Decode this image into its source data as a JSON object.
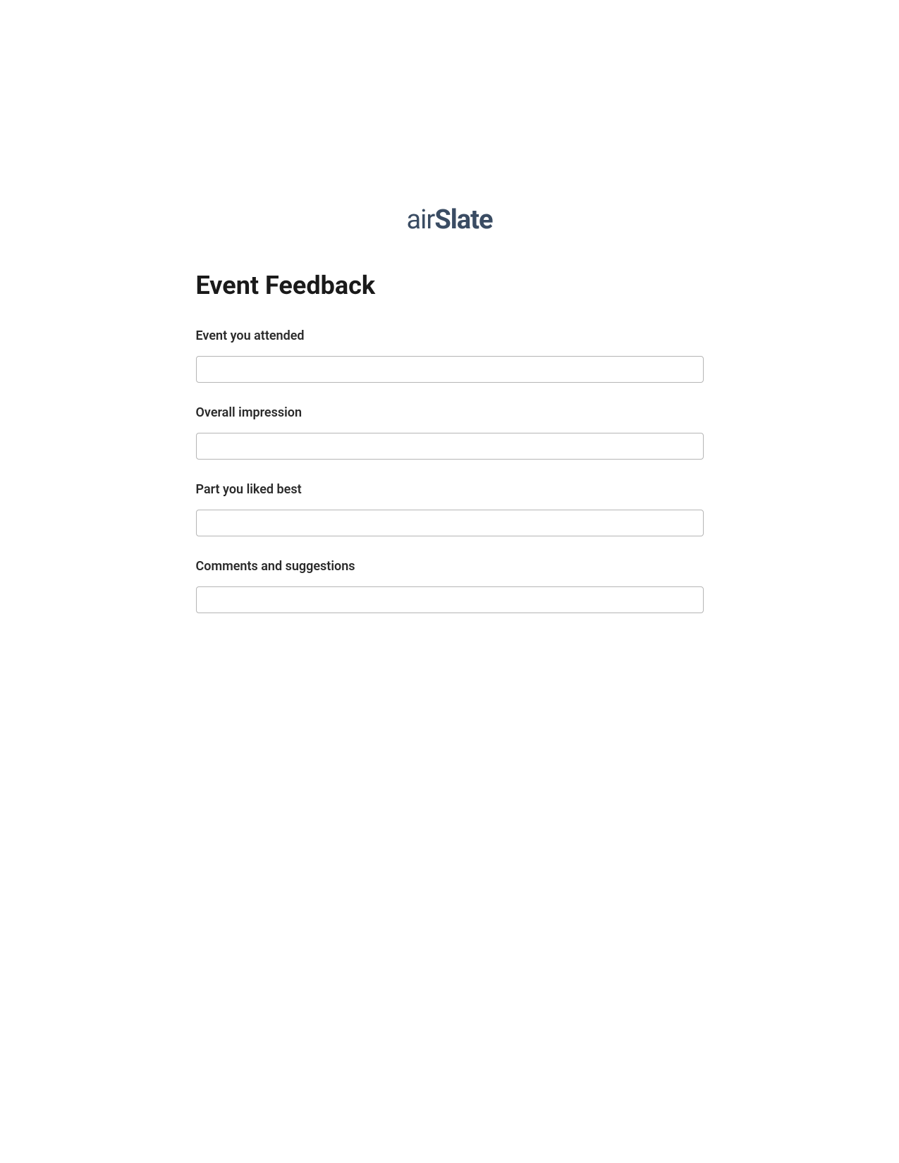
{
  "logo": {
    "part1": "air",
    "part2": "Slate"
  },
  "title": "Event Feedback",
  "form": {
    "fields": [
      {
        "label": "Event you attended",
        "value": ""
      },
      {
        "label": "Overall impression",
        "value": ""
      },
      {
        "label": "Part you liked best",
        "value": ""
      },
      {
        "label": "Comments and suggestions",
        "value": ""
      }
    ]
  }
}
